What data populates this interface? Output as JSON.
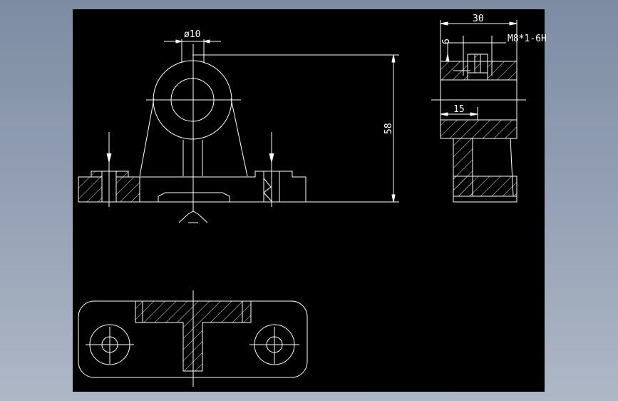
{
  "drawing": {
    "background": "#000000",
    "line_color": "#ffffff",
    "dimensions": {
      "hole_diameter": "ø10",
      "total_height": "58",
      "side_width": "30",
      "thread_depth": "6",
      "thread_spec": "M8*1-6H",
      "side_offset": "15"
    }
  }
}
